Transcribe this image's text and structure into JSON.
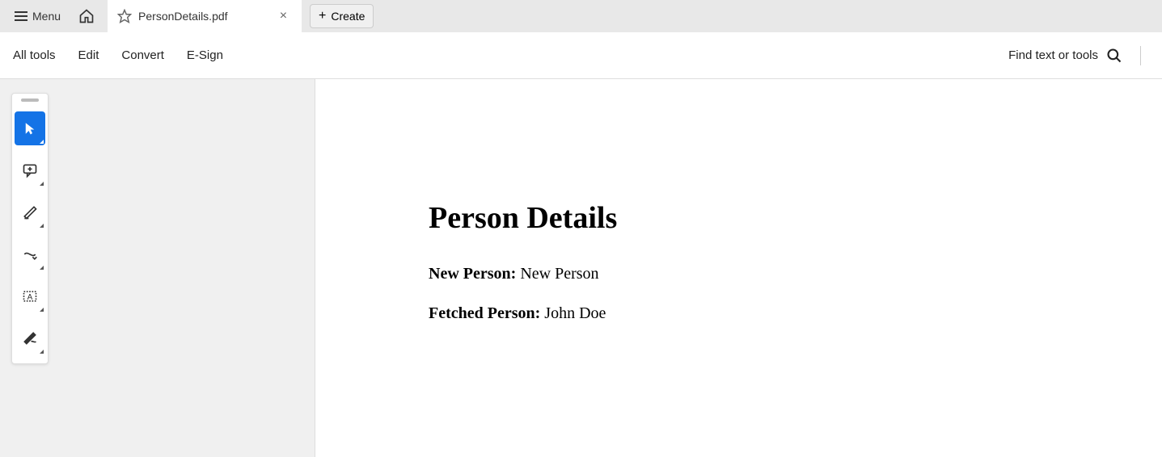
{
  "topbar": {
    "menu_label": "Menu",
    "tab_title": "PersonDetails.pdf",
    "create_label": "Create"
  },
  "toolbar": {
    "items": [
      "All tools",
      "Edit",
      "Convert",
      "E-Sign"
    ],
    "find_label": "Find text or tools"
  },
  "document": {
    "heading": "Person Details",
    "line1_label": "New Person:",
    "line1_value": "New Person",
    "line2_label": "Fetched Person:",
    "line2_value": "John Doe"
  }
}
